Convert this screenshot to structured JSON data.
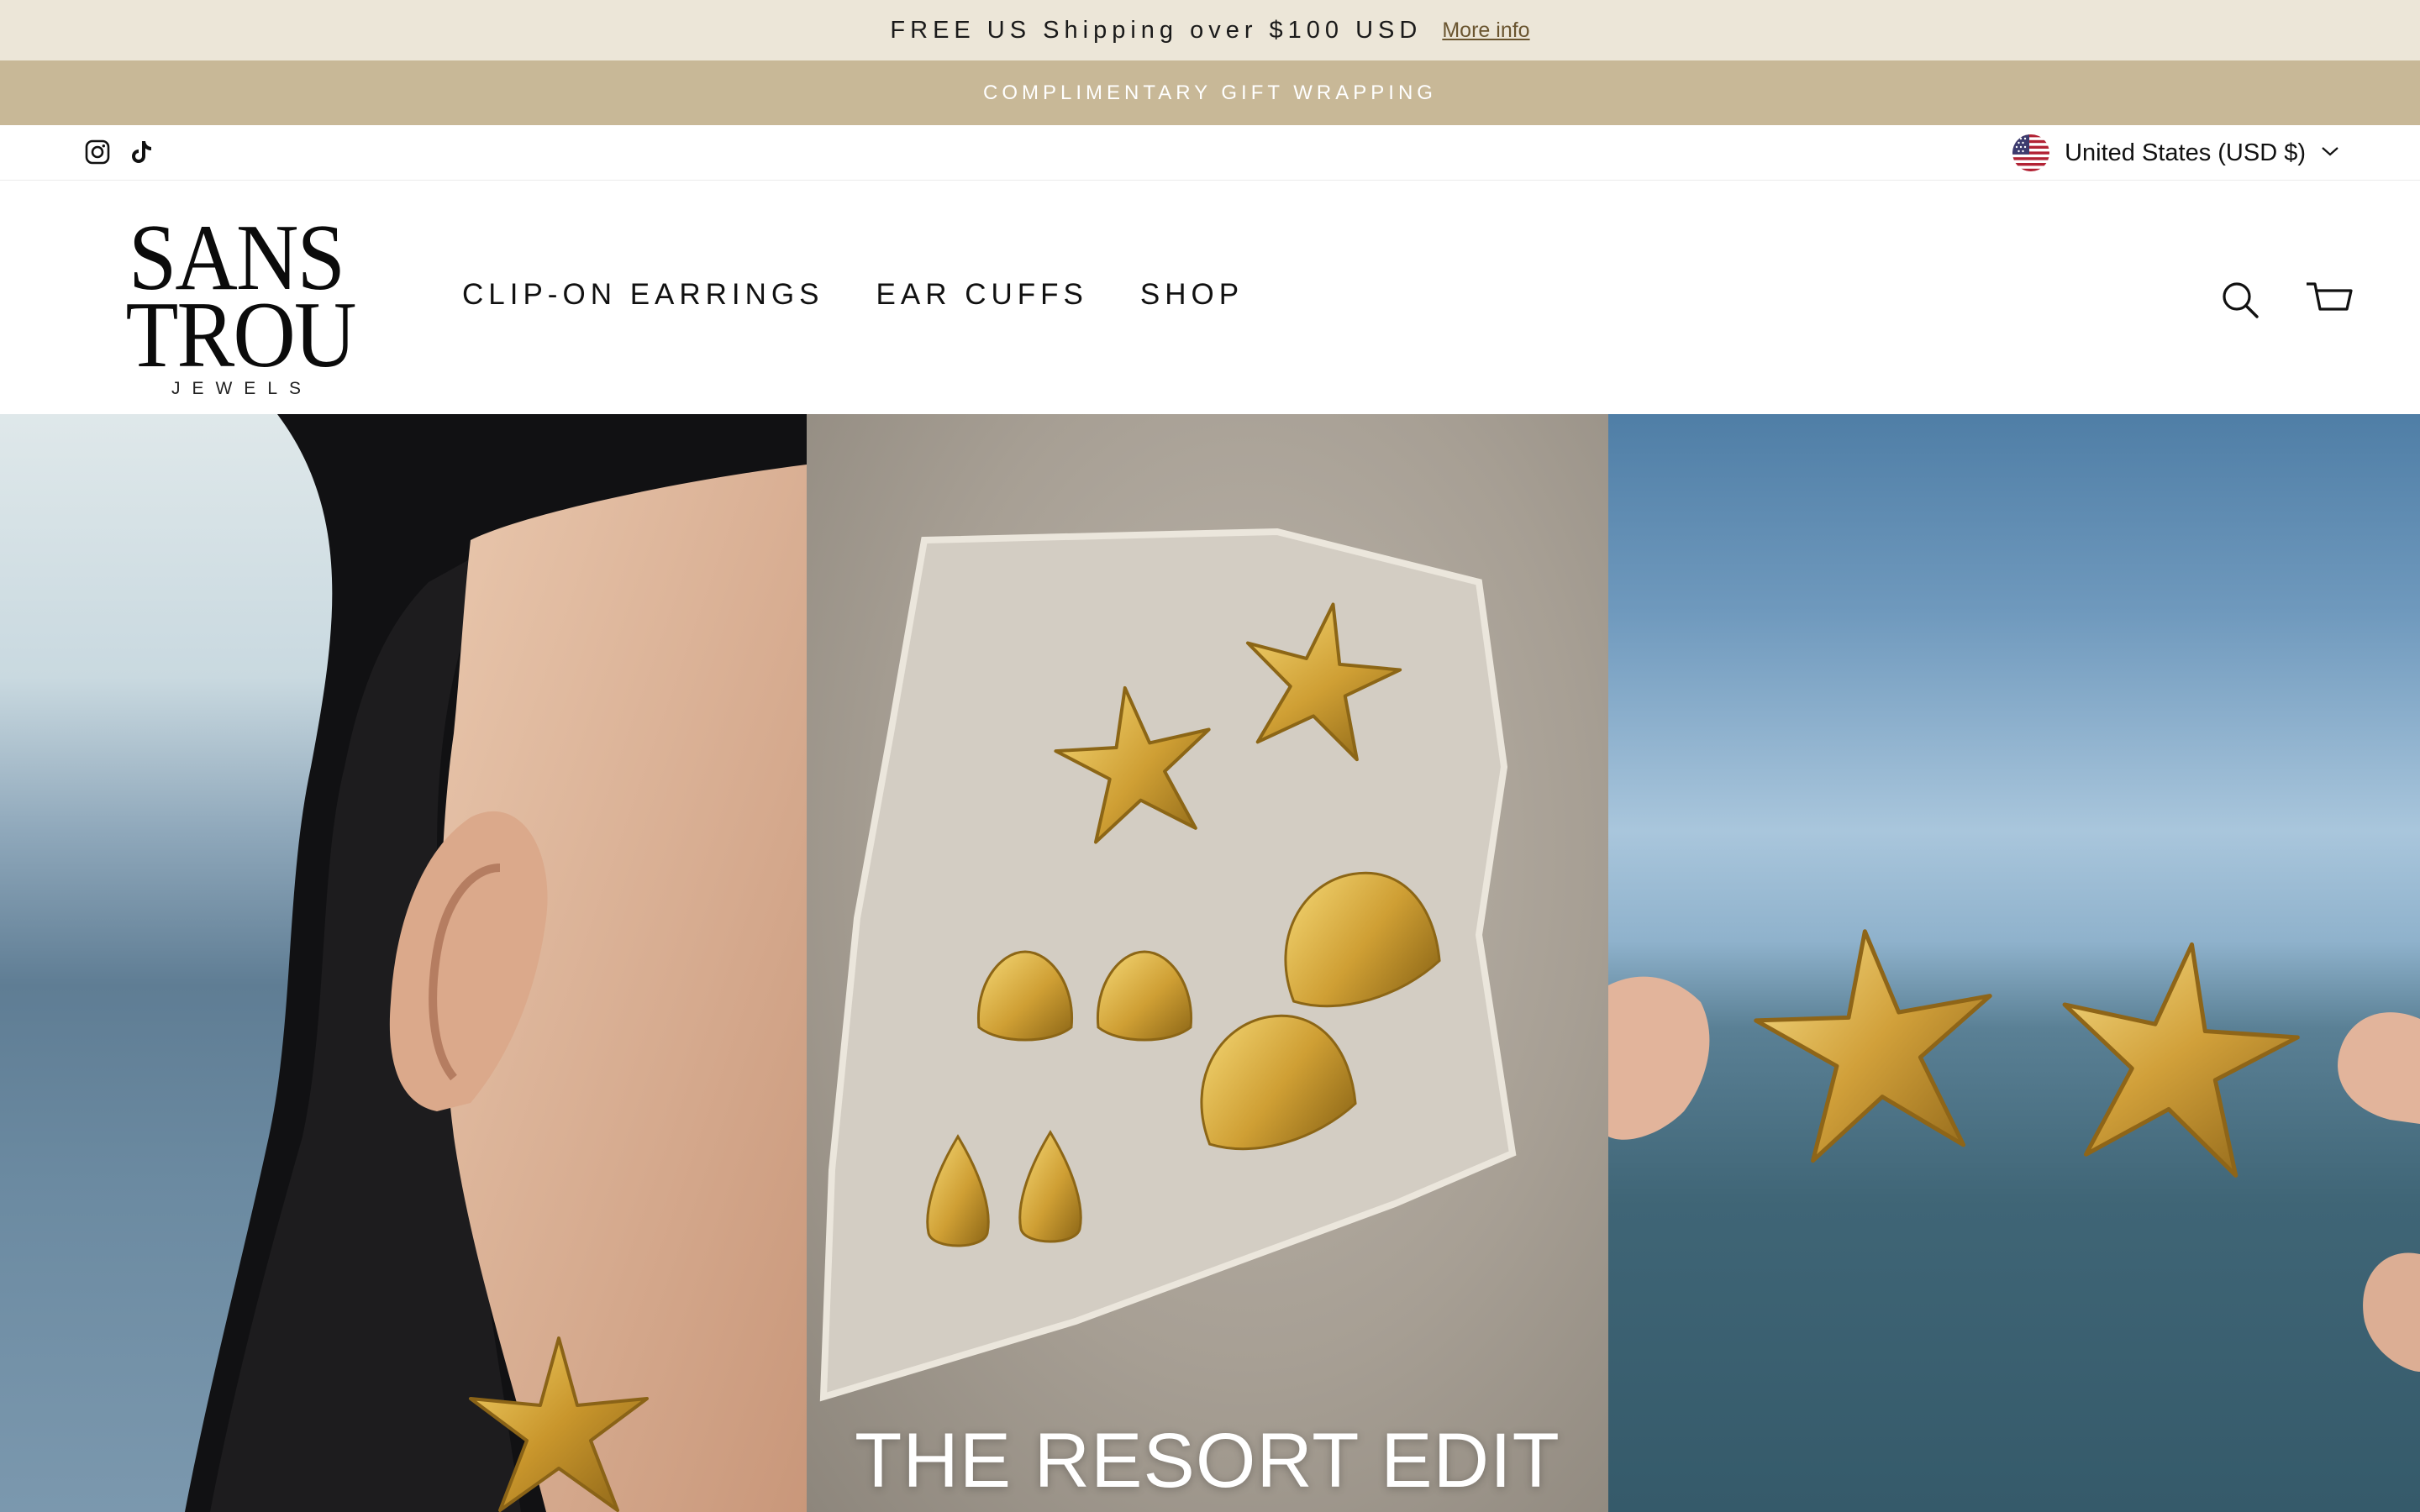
{
  "announcement": {
    "text": "FREE US Shipping over $100 USD",
    "link_label": "More info"
  },
  "gift_bar": {
    "text": "COMPLIMENTARY GIFT WRAPPING"
  },
  "utility": {
    "social_icons": [
      "instagram-icon",
      "tiktok-icon"
    ],
    "currency_label": "United States (USD $)",
    "currency_flag": "us-flag-icon"
  },
  "header": {
    "logo": {
      "line1": "SANS",
      "line2": "TROU",
      "line3": "JEWELS"
    },
    "nav": [
      {
        "label": "CLIP-ON EARRINGS"
      },
      {
        "label": "EAR CUFFS"
      },
      {
        "label": "SHOP"
      }
    ],
    "icons": [
      "search-icon",
      "cart-icon"
    ]
  },
  "hero": {
    "title": "THE RESORT EDIT"
  },
  "colors": {
    "announcement_bg": "#ece6d8",
    "gift_bar_bg": "#c8b897",
    "text": "#111111",
    "link": "#6a5530"
  }
}
